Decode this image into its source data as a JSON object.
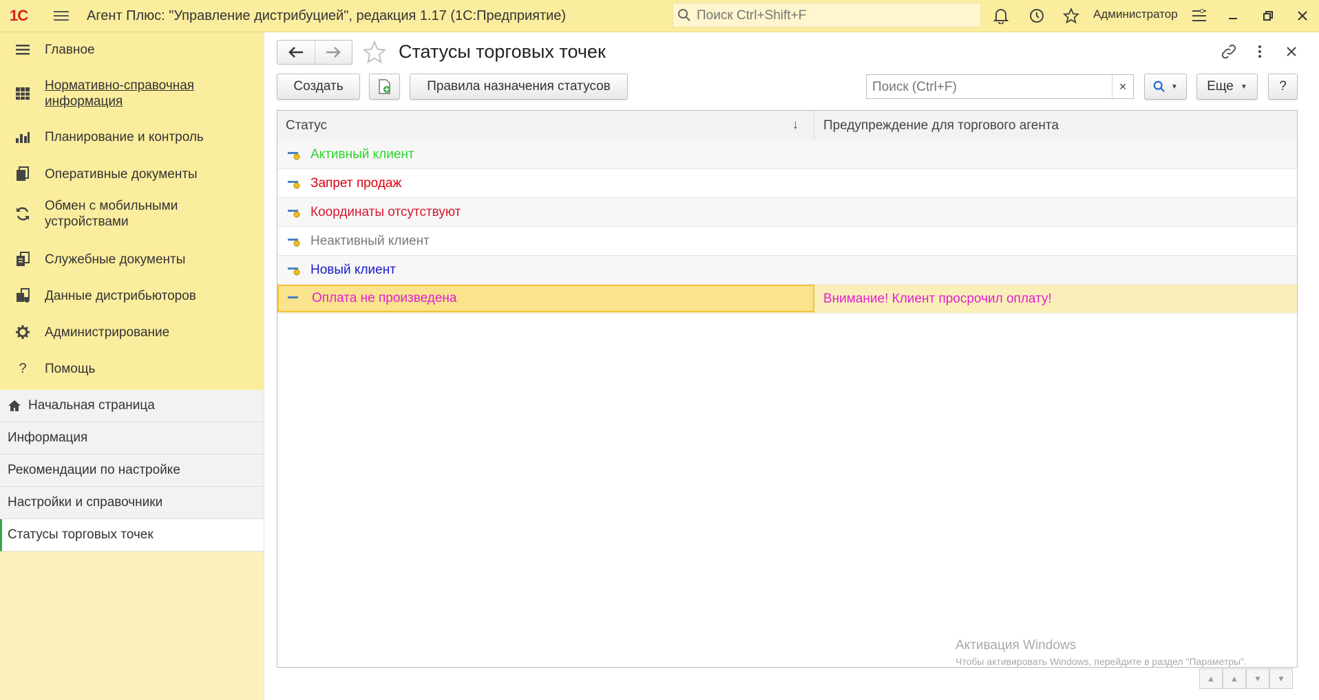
{
  "app": {
    "logo": "1С",
    "title": "Агент Плюс: \"Управление дистрибуцией\", редакция 1.17  (1С:Предприятие)",
    "search_placeholder": "Поиск Ctrl+Shift+F",
    "user": "Администратор"
  },
  "sidebar": {
    "sections": [
      {
        "label": "Главное",
        "icon": "list-icon"
      },
      {
        "label": "Нормативно-справочная информация",
        "icon": "grid-icon"
      },
      {
        "label": "Планирование и контроль",
        "icon": "chart-icon"
      },
      {
        "label": "Оперативные документы",
        "icon": "documents-icon"
      },
      {
        "label": "Обмен с мобильными устройствами",
        "icon": "sync-icon"
      },
      {
        "label": "Служебные документы",
        "icon": "service-docs-icon"
      },
      {
        "label": "Данные дистрибьюторов",
        "icon": "distributor-data-icon"
      },
      {
        "label": "Администрирование",
        "icon": "gear-icon"
      },
      {
        "label": "Помощь",
        "icon": "question-icon"
      }
    ],
    "open_windows": [
      {
        "label": "Начальная страница"
      },
      {
        "label": "Информация"
      },
      {
        "label": "Рекомендации по настройке"
      },
      {
        "label": "Настройки и справочники"
      },
      {
        "label": "Статусы торговых точек"
      }
    ]
  },
  "form": {
    "title": "Статусы торговых точек",
    "create_label": "Создать",
    "rules_label": "Правила назначения статусов",
    "search_placeholder": "Поиск (Ctrl+F)",
    "clear_label": "×",
    "more_label": "Еще",
    "help_label": "?"
  },
  "table": {
    "columns": [
      "Статус",
      "Предупреждение для торгового агента"
    ],
    "sort_indicator": "↓",
    "rows": [
      {
        "status": "Активный клиент",
        "warning": "",
        "color": "#2bd52b"
      },
      {
        "status": "Запрет продаж",
        "warning": "",
        "color": "#e0000f"
      },
      {
        "status": "Координаты отсутствуют",
        "warning": "",
        "color": "#d6162e"
      },
      {
        "status": "Неактивный клиент",
        "warning": "",
        "color": "#7a7a7a"
      },
      {
        "status": "Новый клиент",
        "warning": "",
        "color": "#1a1acc"
      },
      {
        "status": "Оплата не произведена",
        "warning": "Внимание! Клиент просрочил оплату!",
        "color": "#e020d0"
      }
    ]
  },
  "watermark": {
    "line1": "Активация Windows",
    "line2": "Чтобы активировать Windows, перейдите в раздел \"Параметры\"."
  }
}
